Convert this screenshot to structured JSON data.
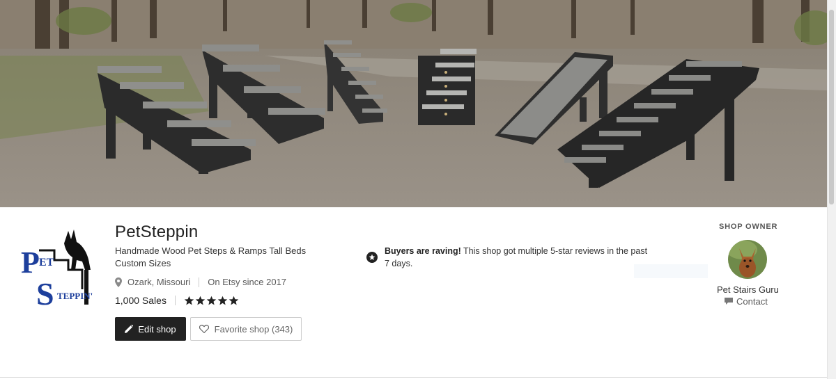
{
  "banner": {
    "image": "pet-steps-and-ramps-photo"
  },
  "shop": {
    "name": "PetSteppin",
    "tagline": "Handmade Wood Pet Steps & Ramps Tall Beds Custom Sizes",
    "location": "Ozark, Missouri",
    "since": "On Etsy since 2017",
    "sales": "1,000 Sales",
    "rating": 5,
    "logo": {
      "text_pet_p": "P",
      "text_pet_et": "ET",
      "text_step_s": "S",
      "text_step_rest": "TEPPIN'"
    }
  },
  "buttons": {
    "edit_label": "Edit shop",
    "favorite_label": "Favorite shop (343)"
  },
  "raving": {
    "bold": "Buyers are raving!",
    "text": " This shop got multiple 5-star reviews in the past 7 days."
  },
  "owner": {
    "heading": "SHOP OWNER",
    "name": "Pet Stairs Guru",
    "contact_label": "Contact"
  },
  "colors": {
    "logo_blue": "#1d3f9c",
    "button_dark": "#222222",
    "star": "#222222"
  }
}
